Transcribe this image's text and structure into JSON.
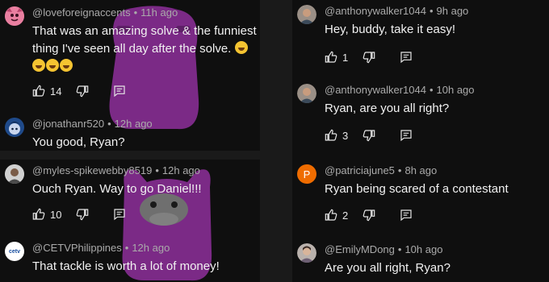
{
  "colors": {
    "background": "#0f0f0f",
    "gap": "#1a1a1a",
    "text": "#f1f1f1",
    "meta": "#aaaaaa",
    "mascot": "#7b2a86"
  },
  "left_top": {
    "comments": [
      {
        "handle": "@loveforeignaccents",
        "time": "11h ago",
        "text_line1": "That was an amazing solve & the funniest",
        "text_line2": "thing I've seen all day after the solve.",
        "likes": "14",
        "avatar_icon": "pink-character-avatar-icon"
      },
      {
        "handle": "@jonathanr520",
        "time": "12h ago",
        "text": "You good, Ryan?",
        "avatar_icon": "blue-anime-avatar-icon"
      }
    ]
  },
  "left_bottom": {
    "comments": [
      {
        "handle": "@myles-spikewebby8519",
        "time": "12h ago",
        "text": "Ouch Ryan. Way to go Daniel!!!",
        "likes": "10",
        "avatar_icon": "person-photo-avatar-icon"
      },
      {
        "handle": "@CETVPhilippines",
        "time": "12h ago",
        "text": "That tackle is worth a lot of money!",
        "avatar_label": "cetv"
      }
    ]
  },
  "right": {
    "comments": [
      {
        "handle": "@anthonywalker1044",
        "time": "9h ago",
        "text": "Hey, buddy, take it easy!",
        "likes": "1",
        "avatar_icon": "person-photo-avatar-icon"
      },
      {
        "handle": "@anthonywalker1044",
        "time": "10h ago",
        "text": "Ryan, are you all right?",
        "likes": "3",
        "avatar_icon": "person-photo-avatar-icon"
      },
      {
        "handle": "@patriciajune5",
        "time": "8h ago",
        "text": "Ryan being scared of a contestant",
        "likes": "2",
        "avatar_letter": "P",
        "avatar_color": "#ef6c00"
      },
      {
        "handle": "@EmilyMDong",
        "time": "10h ago",
        "text": "Are you all right, Ryan?",
        "avatar_icon": "person-photo-avatar-icon"
      }
    ]
  },
  "separator": "•"
}
